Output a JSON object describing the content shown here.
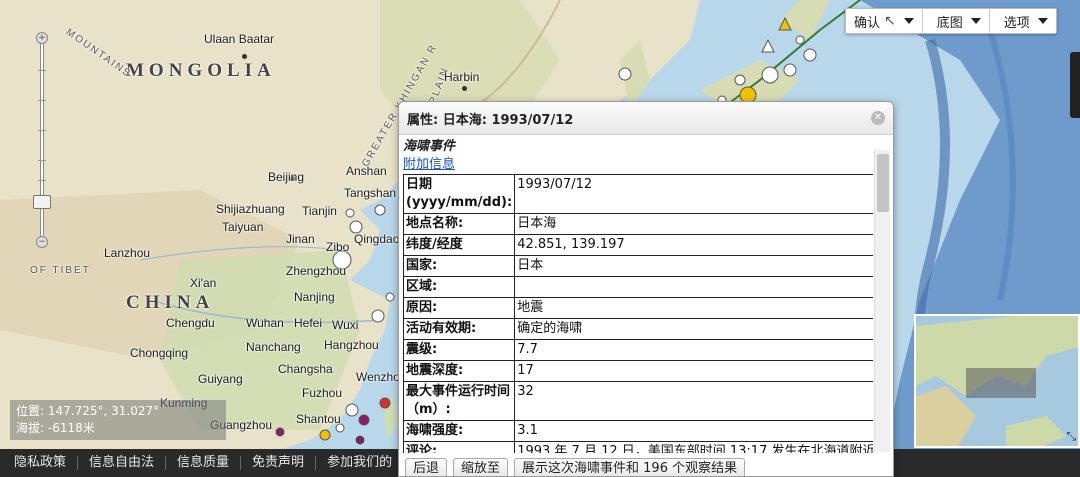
{
  "map": {
    "labels": {
      "mongolia": "MONGOLIA",
      "china": "CHINA",
      "ulaanbaatar": "Ulaan Baatar",
      "harbin": "Harbin",
      "beijing": "Beijing",
      "anshan": "Anshan",
      "tangshan": "Tangshan",
      "tianjin": "Tianjin",
      "shijiazhuang": "Shijiazhuang",
      "taiyuan": "Taiyuan",
      "jinan": "Jinan",
      "zibo": "Zibo",
      "qingdao": "Qingdao",
      "lanzhou": "Lanzhou",
      "xian": "Xi'an",
      "zhengzhou": "Zhengzhou",
      "nanjing": "Nanjing",
      "chengdu": "Chengdu",
      "wuhan": "Wuhan",
      "hefei": "Hefei",
      "wuxi": "Wuxi",
      "chongqing": "Chongqing",
      "nanchang": "Nanchang",
      "hangzhou": "Hangzhou",
      "changsha": "Changsha",
      "guiyang": "Guiyang",
      "fuzhou": "Fuzhou",
      "wenzhou": "Wenzhou",
      "kunming": "Kunming",
      "guangzhou": "Guangzhou",
      "shantou": "Shantou",
      "mountains": "MOUNTAINS",
      "tibet": "OF TIBET",
      "khingan": "GREATER KHINGAN R",
      "plain": "PLAIN"
    },
    "colors": {
      "land": "#e8e2c8",
      "land_green": "#cfdcb0",
      "ocean": "#b9d7ea",
      "deep_ocean": "#5f8fc4",
      "trench": "#3d6aa8"
    }
  },
  "toolbar": {
    "confirm_label": "确认",
    "basemap_label": "底图",
    "options_label": "选项"
  },
  "coords": {
    "position": "位置: 147.725°, 31.027°",
    "elevation": "海拔: -6118米"
  },
  "popup": {
    "title": "属性: 日本海: 1993/07/12",
    "section_title": "海啸事件",
    "more_info_link": "附加信息",
    "rows": [
      {
        "key": "日期\n(yyyy/mm/dd):",
        "value": "1993/07/12"
      },
      {
        "key": "地点名称:",
        "value": "日本海"
      },
      {
        "key": "纬度/经度",
        "value": "42.851, 139.197"
      },
      {
        "key": "国家:",
        "value": "日本"
      },
      {
        "key": "区域:",
        "value": ""
      },
      {
        "key": "原因:",
        "value": "地震"
      },
      {
        "key": "活动有效期:",
        "value": "确定的海啸"
      },
      {
        "key": "震级:",
        "value": "7.7"
      },
      {
        "key": "地震深度:",
        "value": "17"
      },
      {
        "key": "最大事件运行时间（m）:",
        "value": "32"
      },
      {
        "key": "海啸强度:",
        "value": "3.1"
      },
      {
        "key": "评论:",
        "value": "1993 年 7 月 12 日，美国东部时间 13:17 发生在北海道附近"
      }
    ],
    "buttons": {
      "back": "后退",
      "zoom_to": "缩放至",
      "show_results": "展示这次海啸事件和 196 个观察结果"
    }
  },
  "footer": {
    "links": [
      "隐私政策",
      "信息自由法",
      "信息质量",
      "免责声明",
      "参加我们的"
    ]
  }
}
